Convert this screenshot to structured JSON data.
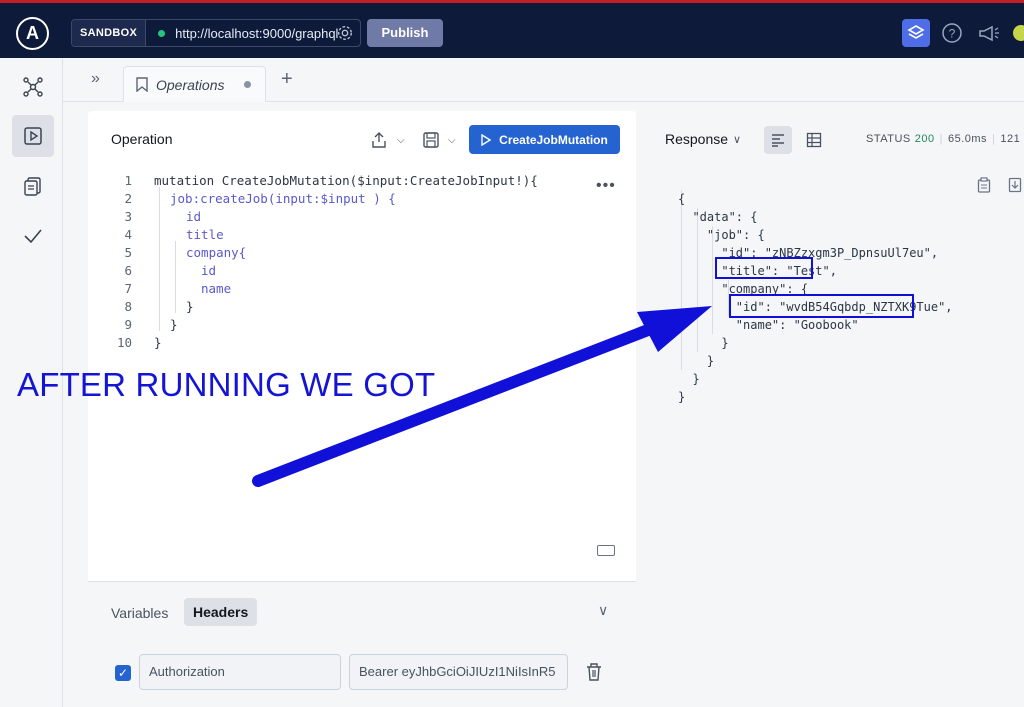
{
  "top_bar": {
    "env_badge": "SANDBOX",
    "url": "http://localhost:9000/graphql",
    "publish_label": "Publish"
  },
  "tabs": {
    "active_tab_label": "Operations"
  },
  "operation_panel": {
    "title": "Operation",
    "run_button_label": "CreateJobMutation",
    "code_lines": [
      {
        "n": "1",
        "text": "mutation CreateJobMutation($input:CreateJobInput!){"
      },
      {
        "n": "2",
        "text": "job:createJob(input:$input ) {"
      },
      {
        "n": "3",
        "text": "id"
      },
      {
        "n": "4",
        "text": "title"
      },
      {
        "n": "5",
        "text": "company{"
      },
      {
        "n": "6",
        "text": "id"
      },
      {
        "n": "7",
        "text": "name"
      },
      {
        "n": "8",
        "text": "}"
      },
      {
        "n": "9",
        "text": "}"
      },
      {
        "n": "10",
        "text": "}"
      }
    ]
  },
  "bottom_panel": {
    "variables_tab": "Variables",
    "headers_tab": "Headers",
    "header_key": "Authorization",
    "header_value": "Bearer eyJhbGciOiJIUzI1NiIsInR5"
  },
  "response": {
    "label": "Response",
    "status_label": "STATUS",
    "status_code": "200",
    "time": "65.0ms",
    "size_partial": "121",
    "json_lines": [
      "{",
      "  \"data\": {",
      "    \"job\": {",
      "      \"id\": \"zNBZzxgm3P_DpnsuUl7eu\",",
      "      \"title\": \"Test\",",
      "      \"company\": {",
      "        \"id\": \"wvdB54Gqbdp_NZTXK9Tue\",",
      "        \"name\": \"Goobook\"",
      "      }",
      "    }",
      "  }",
      "}"
    ]
  },
  "annotation": {
    "text": "AFTER RUNNING WE GOT",
    "color": "#1414d4"
  },
  "colors": {
    "topbar": "#0e1a3a",
    "run_button": "#2563d0",
    "annotation_blue": "#1010d8"
  }
}
